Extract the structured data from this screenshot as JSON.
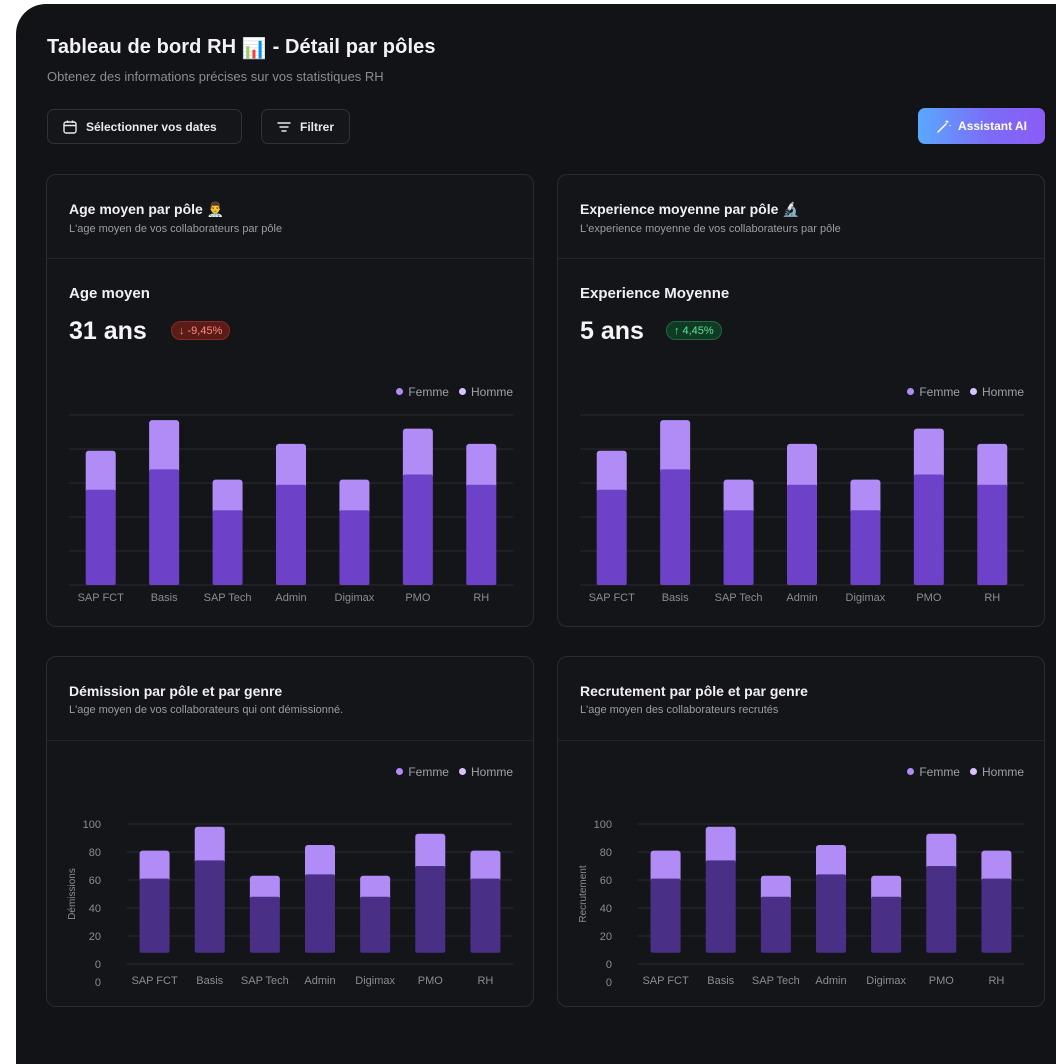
{
  "header": {
    "title": "Tableau de bord RH",
    "title_emoji": "📊",
    "title_suffix": "- Détail par pôles",
    "subtitle": "Obtenez des informations précises sur vos statistiques RH"
  },
  "toolbar": {
    "dates_label": "Sélectionner vos dates",
    "filter_label": "Filtrer",
    "ai_label": "Assistant AI"
  },
  "colors": {
    "femme": "#b18cf7",
    "homme": "#6d42c8",
    "homme_dark": "#4a2f87",
    "background": "#121316"
  },
  "legend": {
    "femme": "Femme",
    "homme": "Homme"
  },
  "cards": {
    "age": {
      "title": "Age moyen par pôle 👨‍⚕️",
      "subtitle": "L'age moyen de vos collaborateurs par pôle",
      "metric_label": "Age moyen",
      "metric_value": "31 ans",
      "delta": "-9,45%",
      "delta_arrow": "↓"
    },
    "experience": {
      "title": "Experience moyenne par pôle 🔬",
      "subtitle": "L'experience moyenne de vos collaborateurs par pôle",
      "metric_label": "Experience Moyenne",
      "metric_value": "5 ans",
      "delta": "4,45%",
      "delta_arrow": "↑"
    },
    "demission": {
      "title": "Démission par pôle et par genre",
      "subtitle": "L'age moyen de vos collaborateurs qui ont démissionné."
    },
    "recrutement": {
      "title": "Recrutement par pôle et par genre",
      "subtitle": "L'age moyen des collaborateurs recrutés"
    }
  },
  "chart_data": [
    {
      "type": "bar",
      "stacked": true,
      "categories": [
        "SAP FCT",
        "Basis",
        "SAP Tech",
        "Admin",
        "Digimax",
        "PMO",
        "RH"
      ],
      "series": [
        {
          "name": "Homme",
          "values": [
            56,
            68,
            44,
            59,
            44,
            65,
            59
          ]
        },
        {
          "name": "Femme",
          "values": [
            23,
            29,
            18,
            24,
            18,
            27,
            24
          ]
        }
      ],
      "ylim": [
        0,
        100
      ],
      "grid": true,
      "legend": "top-right"
    },
    {
      "type": "bar",
      "stacked": true,
      "categories": [
        "SAP FCT",
        "Basis",
        "SAP Tech",
        "Admin",
        "Digimax",
        "PMO",
        "RH"
      ],
      "series": [
        {
          "name": "Homme",
          "values": [
            56,
            68,
            44,
            59,
            44,
            65,
            59
          ]
        },
        {
          "name": "Femme",
          "values": [
            23,
            29,
            18,
            24,
            18,
            27,
            24
          ]
        }
      ],
      "ylim": [
        0,
        100
      ],
      "grid": true,
      "legend": "top-right"
    },
    {
      "type": "bar",
      "stacked": true,
      "ylabel": "Démissions",
      "categories": [
        "SAP FCT",
        "Basis",
        "SAP Tech",
        "Admin",
        "Digimax",
        "PMO",
        "RH"
      ],
      "series": [
        {
          "name": "Homme",
          "values": [
            61,
            74,
            48,
            64,
            48,
            70,
            61
          ]
        },
        {
          "name": "Femme",
          "values": [
            20,
            24,
            15,
            21,
            15,
            23,
            20
          ]
        }
      ],
      "yticks": [
        0,
        20,
        40,
        60,
        80,
        100
      ],
      "ylim": [
        0,
        100
      ],
      "grid": true,
      "legend": "top-right"
    },
    {
      "type": "bar",
      "stacked": true,
      "ylabel": "Recrutement",
      "categories": [
        "SAP FCT",
        "Basis",
        "SAP Tech",
        "Admin",
        "Digimax",
        "PMO",
        "RH"
      ],
      "series": [
        {
          "name": "Homme",
          "values": [
            61,
            74,
            48,
            64,
            48,
            70,
            61
          ]
        },
        {
          "name": "Femme",
          "values": [
            20,
            24,
            15,
            21,
            15,
            23,
            20
          ]
        }
      ],
      "yticks": [
        0,
        20,
        40,
        60,
        80,
        100
      ],
      "ylim": [
        0,
        100
      ],
      "grid": true,
      "legend": "top-right"
    }
  ]
}
